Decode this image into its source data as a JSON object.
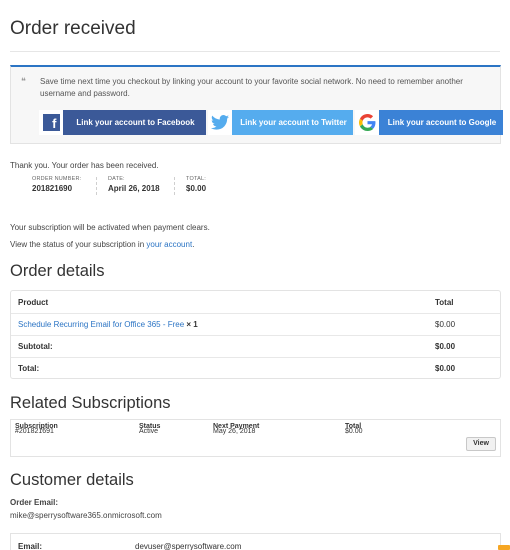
{
  "page": {
    "title": "Order received"
  },
  "social": {
    "message": "Save time next time you checkout by linking your account to your favorite social network. No need to remember another username and password.",
    "facebook_label": "Link your account to Facebook",
    "twitter_label": "Link your account to Twitter",
    "google_label": "Link your account to Google",
    "accent_color": "#2b74c4"
  },
  "thanks": "Thank you. Your order has been received.",
  "overview": {
    "order_number_label": "ORDER NUMBER:",
    "order_number": "201821690",
    "date_label": "DATE:",
    "date": "April 26, 2018",
    "total_label": "TOTAL:",
    "total": "$0.00"
  },
  "subscription_note": "Your subscription will be activated when payment clears.",
  "status_prefix": "View the status of your subscription in ",
  "status_link": "your account",
  "status_suffix": ".",
  "order_details": {
    "heading": "Order details",
    "col_product": "Product",
    "col_total": "Total",
    "item_name": "Schedule Recurring Email for Office 365 - Free",
    "item_qty": "× 1",
    "item_total": "$0.00",
    "subtotal_label": "Subtotal:",
    "subtotal_value": "$0.00",
    "total_label": "Total:",
    "total_value": "$0.00"
  },
  "related": {
    "heading": "Related Subscriptions",
    "col_subscription": "Subscription",
    "col_status": "Status",
    "col_next_payment": "Next Payment",
    "col_total": "Total",
    "rows": [
      {
        "subscription": "#201821691",
        "status": "Active",
        "next_payment": "May 26, 2018",
        "total": "$0.00",
        "action": "View"
      }
    ]
  },
  "customer": {
    "heading": "Customer details",
    "order_email_label": "Order Email:",
    "order_email": "mike@sperrysoftware365.onmicrosoft.com",
    "email_label": "Email:",
    "email_value": "devuser@sperrysoftware.com"
  }
}
